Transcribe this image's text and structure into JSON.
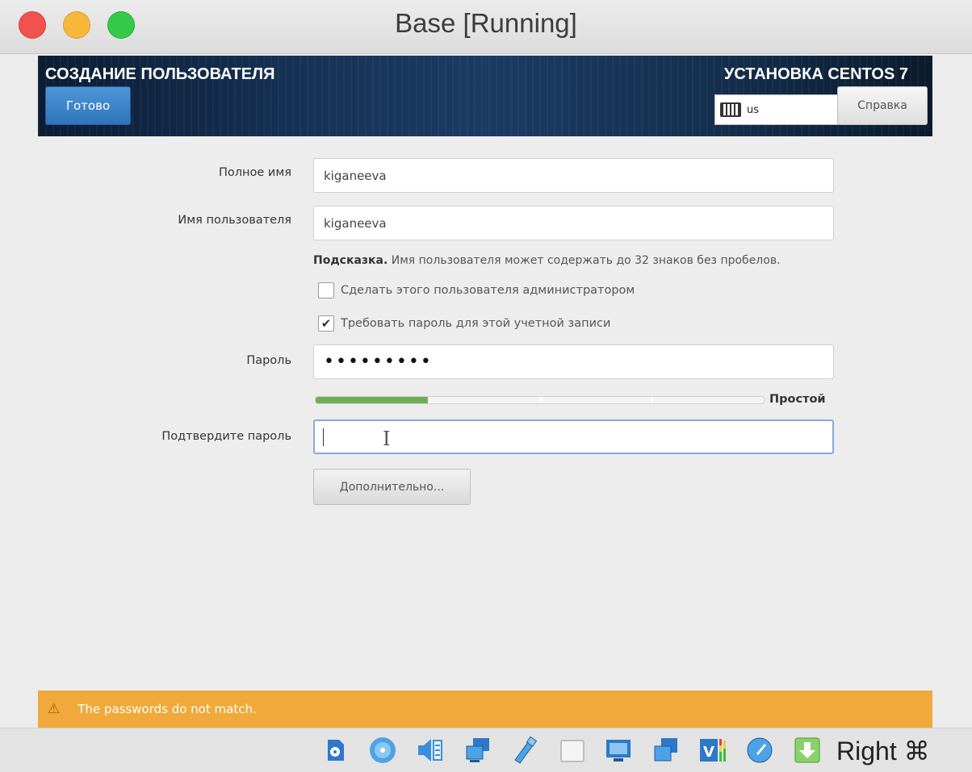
{
  "window": {
    "title": "Base [Running]"
  },
  "header": {
    "title": "СОЗДАНИЕ ПОЛЬЗОВАТЕЛЯ",
    "product": "УСТАНОВКА CENTOS 7",
    "done_label": "Готово",
    "keyboard_layout": "us",
    "help_label": "Справка"
  },
  "form": {
    "fullname_label": "Полное имя",
    "fullname_value": "kiganeeva",
    "username_label": "Имя пользователя",
    "username_value": "kiganeeva",
    "hint_bold": "Подсказка.",
    "hint_text": " Имя пользователя может содержать до 32 знаков без пробелов.",
    "admin_checkbox_label": "Сделать этого пользователя администратором",
    "admin_checked": false,
    "require_password_label": "Требовать пароль для этой учетной записи",
    "require_password_checked": true,
    "password_label": "Пароль",
    "password_value": "•••••••••",
    "strength_fraction": 0.25,
    "strength_label": "Простой",
    "confirm_label": "Подтвердите пароль",
    "confirm_value": "",
    "advanced_label": "Дополнительно..."
  },
  "warning": {
    "text": "The passwords do not match."
  },
  "statusbar": {
    "icons": [
      "hard-disk-icon",
      "optical-disk-icon",
      "audio-icon",
      "network-icon",
      "usb-icon",
      "shared-folders-icon",
      "display-icon",
      "video-capture-icon",
      "cpu-usage-icon",
      "mouse-integration-icon",
      "download-icon"
    ],
    "host_key": "Right ⌘"
  },
  "colors": {
    "warning": "#f0a93a",
    "accent": "#3a82c8",
    "strength": "#6fae57"
  }
}
